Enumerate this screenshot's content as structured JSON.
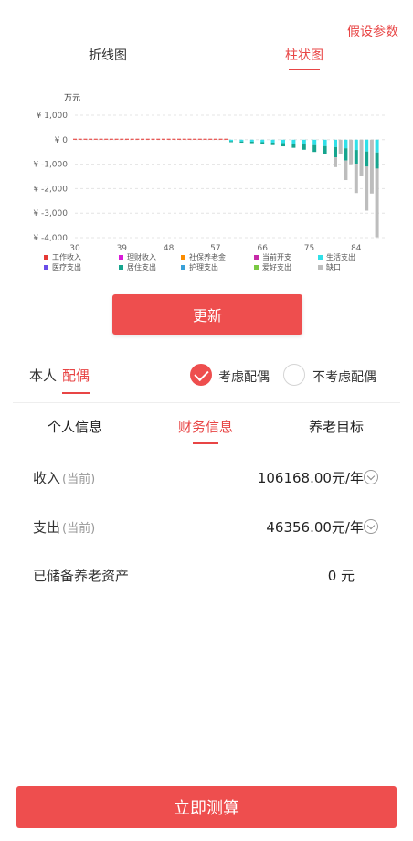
{
  "header": {
    "assume_params_link": "假设参数"
  },
  "chart_tabs": {
    "line": "折线图",
    "bar": "柱状图"
  },
  "chart_data": {
    "type": "bar",
    "stacked": true,
    "ylabel": "万元",
    "ylim": [
      -4000,
      1000
    ],
    "y_ticks": [
      "¥ 1,000",
      "¥ 0",
      "¥ -1,000",
      "¥ -2,000",
      "¥ -3,000",
      "¥ -4,000"
    ],
    "y_tick_values": [
      1000,
      0,
      -1000,
      -2000,
      -3000,
      -4000
    ],
    "x_ticks": [
      30,
      39,
      48,
      57,
      66,
      75,
      84
    ],
    "x_range": [
      30,
      89
    ],
    "grid": true,
    "legend_position": "bottom",
    "legend": [
      {
        "name": "工作收入",
        "color": "#e53935"
      },
      {
        "name": "理财收入",
        "color": "#d81bd8"
      },
      {
        "name": "社保养老金",
        "color": "#fb8c00"
      },
      {
        "name": "当前开支",
        "color": "#c62aa8"
      },
      {
        "name": "生活支出",
        "color": "#30e0e8"
      },
      {
        "name": "医疗支出",
        "color": "#6a4de8"
      },
      {
        "name": "居住支出",
        "color": "#16a58e"
      },
      {
        "name": "护理支出",
        "color": "#3aa0d8"
      },
      {
        "name": "爱好支出",
        "color": "#7ac943"
      },
      {
        "name": "缺口",
        "color": "#bdbdbd"
      }
    ],
    "series": [
      {
        "name": "工作收入",
        "x": [
          30,
          31,
          32,
          33,
          34,
          35,
          36,
          37,
          38,
          39,
          40,
          41,
          42,
          43,
          44,
          45,
          46,
          47,
          48,
          49,
          50,
          51,
          52,
          53,
          54,
          55,
          56,
          57,
          58,
          59
        ],
        "values": [
          40,
          40,
          40,
          40,
          40,
          40,
          40,
          40,
          40,
          40,
          40,
          40,
          40,
          40,
          40,
          40,
          40,
          40,
          40,
          40,
          40,
          40,
          40,
          40,
          40,
          40,
          40,
          40,
          40,
          40
        ]
      },
      {
        "name": "生活支出",
        "x": [
          60,
          62,
          64,
          66,
          68,
          70,
          72,
          74,
          76,
          78,
          80,
          82,
          84,
          86,
          88
        ],
        "values": [
          -60,
          -70,
          -80,
          -100,
          -120,
          -140,
          -160,
          -190,
          -220,
          -260,
          -300,
          -350,
          -420,
          -480,
          -520
        ]
      },
      {
        "name": "居住支出",
        "x": [
          60,
          62,
          64,
          66,
          68,
          70,
          72,
          74,
          76,
          78,
          80,
          82,
          84,
          86,
          88
        ],
        "values": [
          -40,
          -50,
          -60,
          -80,
          -100,
          -130,
          -170,
          -220,
          -280,
          -340,
          -420,
          -500,
          -560,
          -620,
          -660
        ]
      },
      {
        "name": "缺口",
        "x": [
          80,
          81,
          82,
          83,
          84,
          85,
          86,
          87,
          88
        ],
        "values": [
          -400,
          -600,
          -800,
          -1000,
          -1200,
          -1500,
          -1800,
          -2200,
          -2800
        ]
      }
    ]
  },
  "update_button": "更新",
  "spouse": {
    "self_label": "本人",
    "spouse_label": "配偶",
    "consider_label": "考虑配偶",
    "not_consider_label": "不考虑配偶"
  },
  "info_tabs": [
    "个人信息",
    "财务信息",
    "养老目标"
  ],
  "finance": {
    "income_label": "收入",
    "income_sub": "(当前)",
    "income_value": "106168.00元/年",
    "expense_label": "支出",
    "expense_sub": "(当前)",
    "expense_value": "46356.00元/年",
    "assets_label": "已储备养老资产",
    "assets_value": "0  元"
  },
  "calculate_button": "立即测算"
}
